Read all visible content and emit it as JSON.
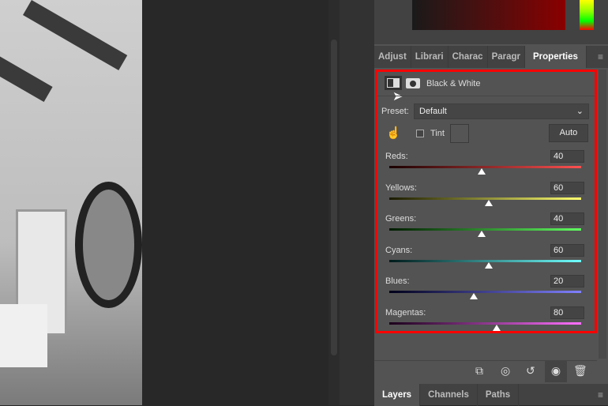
{
  "tabs": [
    {
      "label": "Adjust"
    },
    {
      "label": "Librari"
    },
    {
      "label": "Charac"
    },
    {
      "label": "Paragr"
    },
    {
      "label": "Properties",
      "active": true
    }
  ],
  "properties": {
    "title": "Black & White",
    "preset_label": "Preset:",
    "preset_value": "Default",
    "tint_label": "Tint",
    "tint_checked": false,
    "auto_label": "Auto",
    "sliders": [
      {
        "label": "Reds:",
        "value": "40",
        "gradient": [
          "#1a0000",
          "#ff5050"
        ]
      },
      {
        "label": "Yellows:",
        "value": "60",
        "gradient": [
          "#1a1a00",
          "#ffff70"
        ]
      },
      {
        "label": "Greens:",
        "value": "40",
        "gradient": [
          "#001a00",
          "#60ff60"
        ]
      },
      {
        "label": "Cyans:",
        "value": "60",
        "gradient": [
          "#001a1a",
          "#70ffff"
        ]
      },
      {
        "label": "Blues:",
        "value": "20",
        "gradient": [
          "#00001a",
          "#8080ff"
        ]
      },
      {
        "label": "Magentas:",
        "value": "80",
        "gradient": [
          "#1a001a",
          "#ff70ff"
        ]
      }
    ],
    "slider_range": [
      -200,
      300
    ]
  },
  "footer_icons": [
    "clip-to-layer-icon",
    "view-previous-icon",
    "reset-icon",
    "visibility-eye-icon",
    "trash-icon"
  ],
  "bottom_tabs": [
    {
      "label": "Layers",
      "active": true
    },
    {
      "label": "Channels"
    },
    {
      "label": "Paths"
    }
  ],
  "colors": {
    "highlight": "#ff0000",
    "panel": "#535353"
  }
}
